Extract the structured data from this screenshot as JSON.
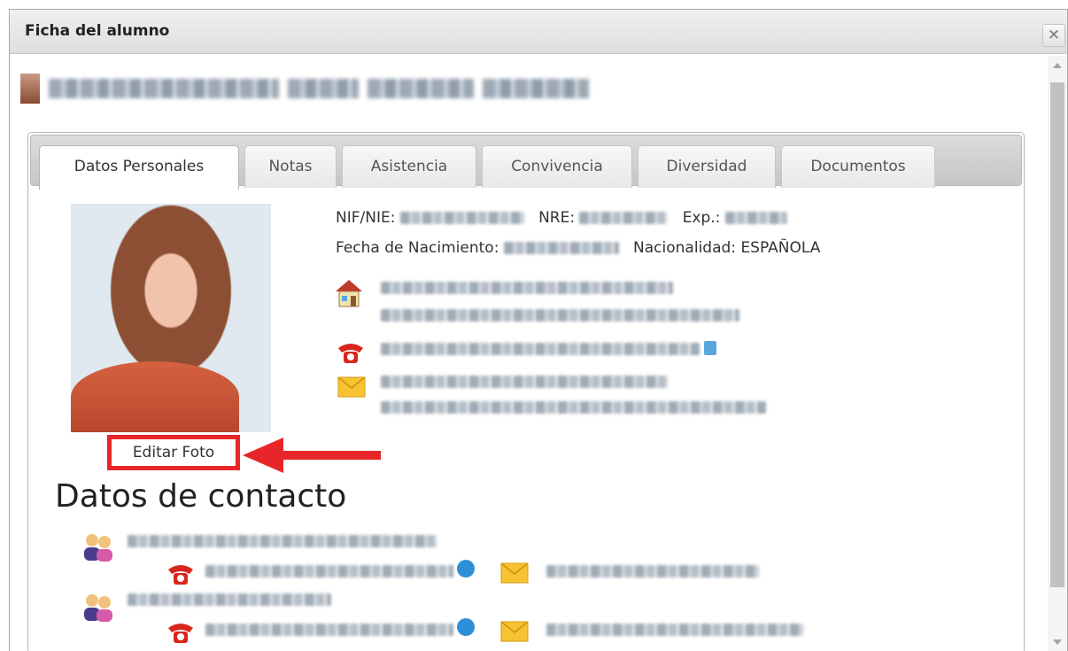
{
  "dialog": {
    "title": "Ficha del alumno",
    "close_label": "×"
  },
  "tabs": [
    {
      "label": "Datos Personales",
      "active": true
    },
    {
      "label": "Notas",
      "active": false
    },
    {
      "label": "Asistencia",
      "active": false
    },
    {
      "label": "Convivencia",
      "active": false
    },
    {
      "label": "Diversidad",
      "active": false
    },
    {
      "label": "Documentos",
      "active": false
    }
  ],
  "personal": {
    "nif_label": "NIF/NIE:",
    "nre_label": "NRE:",
    "exp_label": "Exp.:",
    "birth_label": "Fecha de Nacimiento:",
    "nationality_label": "Nacionalidad:",
    "nationality_value": "ESPAÑOLA"
  },
  "photo": {
    "edit_label": "Editar Foto"
  },
  "contact": {
    "title": "Datos de contacto"
  },
  "colors": {
    "highlight": "#e8262a",
    "accent_blue": "#2e8fd8"
  },
  "icons": [
    "house-icon",
    "phone-icon",
    "mail-icon",
    "parents-icon",
    "telegram-icon",
    "close-icon"
  ]
}
